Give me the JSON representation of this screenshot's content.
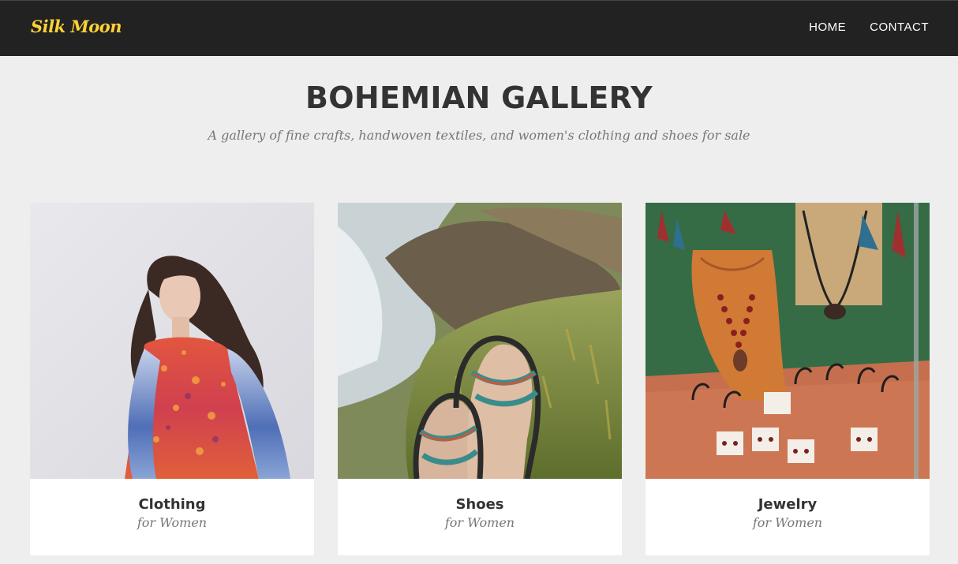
{
  "nav": {
    "brand": "Silk Moon",
    "links": [
      "HOME",
      "CONTACT"
    ]
  },
  "header": {
    "title": "BOHEMIAN GALLERY",
    "subtitle": "A gallery of fine crafts, handwoven textiles, and women's clothing and shoes for sale"
  },
  "cards": [
    {
      "title": "Clothing",
      "subtitle": "for Women",
      "image": "woman-in-bohemian-dress-photo"
    },
    {
      "title": "Shoes",
      "subtitle": "for Women",
      "image": "sandals-on-coastal-grass-photo"
    },
    {
      "title": "Jewelry",
      "subtitle": "for Women",
      "image": "jewelry-display-case-photo"
    }
  ],
  "colors": {
    "navbar": "#222222",
    "brand": "#fed136",
    "background": "#eeeeee",
    "card": "#ffffff"
  }
}
